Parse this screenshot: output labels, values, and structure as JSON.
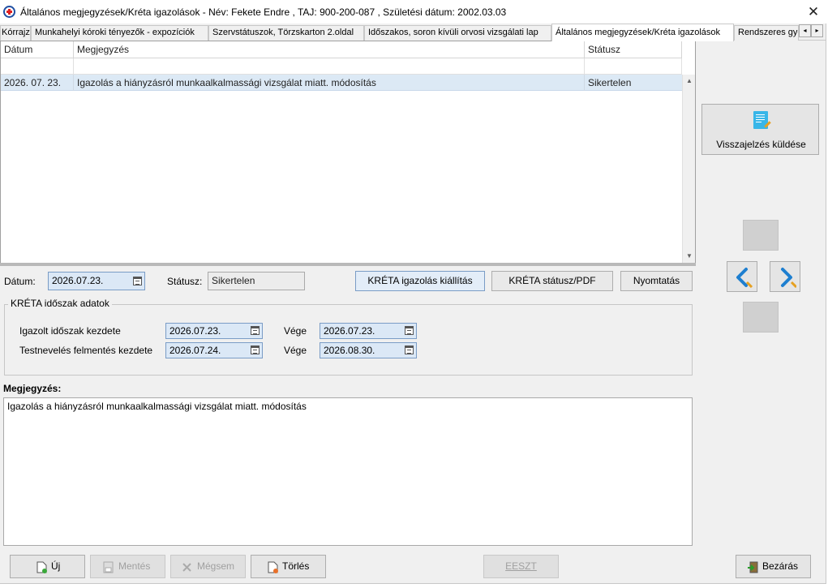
{
  "window": {
    "title": "Általános megjegyzések/Kréta igazolások - Név: Fekete Endre , TAJ: 900-200-087 , Születési dátum: 2002.03.03",
    "close_glyph": "✕"
  },
  "tabs": [
    {
      "label": "Kórrajz",
      "active": false
    },
    {
      "label": "Munkahelyi kóroki tényezők - expozíciók",
      "active": false
    },
    {
      "label": "Szervstátuszok, Törzskarton 2.oldal",
      "active": false
    },
    {
      "label": "Időszakos, soron kívüli orvosi vizsgálati lap",
      "active": false
    },
    {
      "label": "Általános megjegyzések/Kréta igazolások",
      "active": true
    },
    {
      "label": "Rendszeres gyógyszerek",
      "active": false
    }
  ],
  "tab_scroll": {
    "left": "◂",
    "right": "▸"
  },
  "grid": {
    "columns": [
      "Dátum",
      "Megjegyzés",
      "Státusz"
    ],
    "rows": [
      {
        "datum": "2026. 07. 23.",
        "megjegyzes": "Igazolás a hiányzásról munkaalkalmassági vizsgálat miatt. módosítás",
        "statusz": "Sikertelen"
      }
    ],
    "scroll_up": "▲",
    "scroll_down": "▼"
  },
  "form": {
    "datum_label": "Dátum:",
    "datum_value": "2026.07.23.",
    "statusz_label": "Státusz:",
    "statusz_value": "Sikertelen",
    "btn_kreta_kiallitas": "KRÉTA igazolás kiállítás",
    "btn_kreta_statusz": "KRÉTA státusz/PDF",
    "btn_nyomtatas": "Nyomtatás"
  },
  "kreta_group": {
    "title": "KRÉTA időszak adatok",
    "row1_label": "Igazolt időszak kezdete",
    "row1_start": "2026.07.23.",
    "row1_end_label": "Vége",
    "row1_end": "2026.07.23.",
    "row2_label": "Testnevelés felmentés kezdete",
    "row2_start": "2026.07.24.",
    "row2_end_label": "Vége",
    "row2_end": "2026.08.30."
  },
  "memo": {
    "label": "Megjegyzés:",
    "text": "Igazolás a hiányzásról munkaalkalmassági vizsgálat miatt. módosítás"
  },
  "side": {
    "feedback_button": "Visszajelzés küldése",
    "feedback_icon": "document-pen-icon",
    "prev_icon": "chevron-left-icon",
    "next_icon": "chevron-right-icon"
  },
  "bottom": {
    "new": "Új",
    "save": "Mentés",
    "cancel": "Mégsem",
    "delete": "Törlés",
    "eeszt": "EESZT",
    "close": "Bezárás"
  },
  "colors": {
    "accent_blue": "#1e7fd0",
    "selection_row": "#dce9f5",
    "date_field_bg": "#dbe8f6"
  }
}
